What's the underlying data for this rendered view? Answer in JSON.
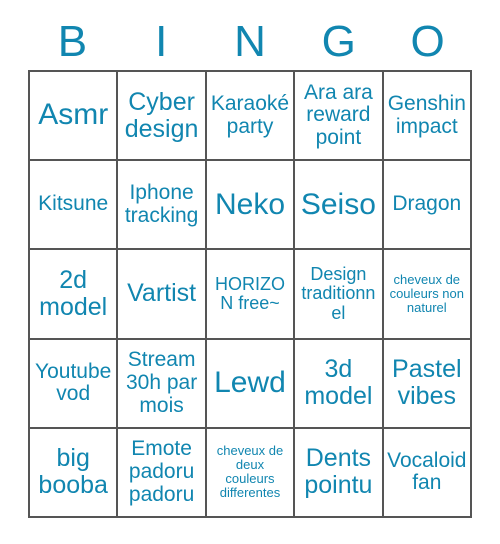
{
  "card": {
    "title_letters": [
      "B",
      "I",
      "N",
      "G",
      "O"
    ],
    "accent_color": "#1186b0",
    "grid_line_color": "#555555",
    "background_color": "#ffffff",
    "columns": 5,
    "rows": 5,
    "cells": [
      {
        "text": "Asmr",
        "size": "fs-xl"
      },
      {
        "text": "Cyber design",
        "size": "fs-lg"
      },
      {
        "text": "Karaoké party",
        "size": "fs-md"
      },
      {
        "text": "Ara ara reward point",
        "size": "fs-md"
      },
      {
        "text": "Genshin impact",
        "size": "fs-md"
      },
      {
        "text": "Kitsune",
        "size": "fs-md"
      },
      {
        "text": "Iphone tracking",
        "size": "fs-md"
      },
      {
        "text": "Neko",
        "size": "fs-xl"
      },
      {
        "text": "Seiso",
        "size": "fs-xl"
      },
      {
        "text": "Dragon",
        "size": "fs-md"
      },
      {
        "text": "2d model",
        "size": "fs-lg"
      },
      {
        "text": "Vartist",
        "size": "fs-lg"
      },
      {
        "text": "HORIZON free~",
        "size": "fs-sm"
      },
      {
        "text": "Design traditionnel",
        "size": "fs-sm"
      },
      {
        "text": "cheveux de couleurs non naturel",
        "size": "fs-xs"
      },
      {
        "text": "Youtube vod",
        "size": "fs-md"
      },
      {
        "text": "Stream 30h par mois",
        "size": "fs-md"
      },
      {
        "text": "Lewd",
        "size": "fs-xl"
      },
      {
        "text": "3d model",
        "size": "fs-lg"
      },
      {
        "text": "Pastel vibes",
        "size": "fs-lg"
      },
      {
        "text": "big booba",
        "size": "fs-lg"
      },
      {
        "text": "Emote padoru padoru",
        "size": "fs-md"
      },
      {
        "text": "cheveux de deux couleurs differentes",
        "size": "fs-xs"
      },
      {
        "text": "Dents pointu",
        "size": "fs-lg"
      },
      {
        "text": "Vocaloid fan",
        "size": "fs-md"
      }
    ]
  }
}
